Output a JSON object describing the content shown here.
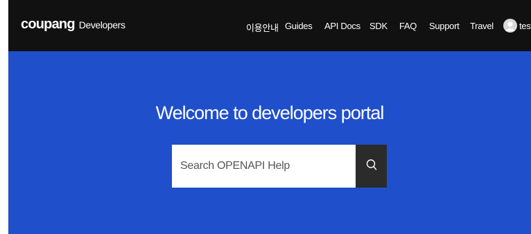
{
  "header": {
    "logo_main": "coupang",
    "logo_sub": "Developers",
    "nav": [
      {
        "label": "이용안내"
      },
      {
        "label": "Guides"
      },
      {
        "label": "API Docs"
      },
      {
        "label": "SDK"
      },
      {
        "label": "FAQ"
      },
      {
        "label": "Support"
      },
      {
        "label": "Travel"
      }
    ],
    "user_name": "test"
  },
  "hero": {
    "title": "Welcome to developers portal",
    "search_placeholder": "Search OPENAPI Help",
    "search_value": ""
  },
  "colors": {
    "navbar": "#111111",
    "hero_background": "#1f4fcb",
    "search_button": "#2b2b2b"
  },
  "icons": {
    "search": "search-icon",
    "avatar": "user-avatar-icon"
  }
}
